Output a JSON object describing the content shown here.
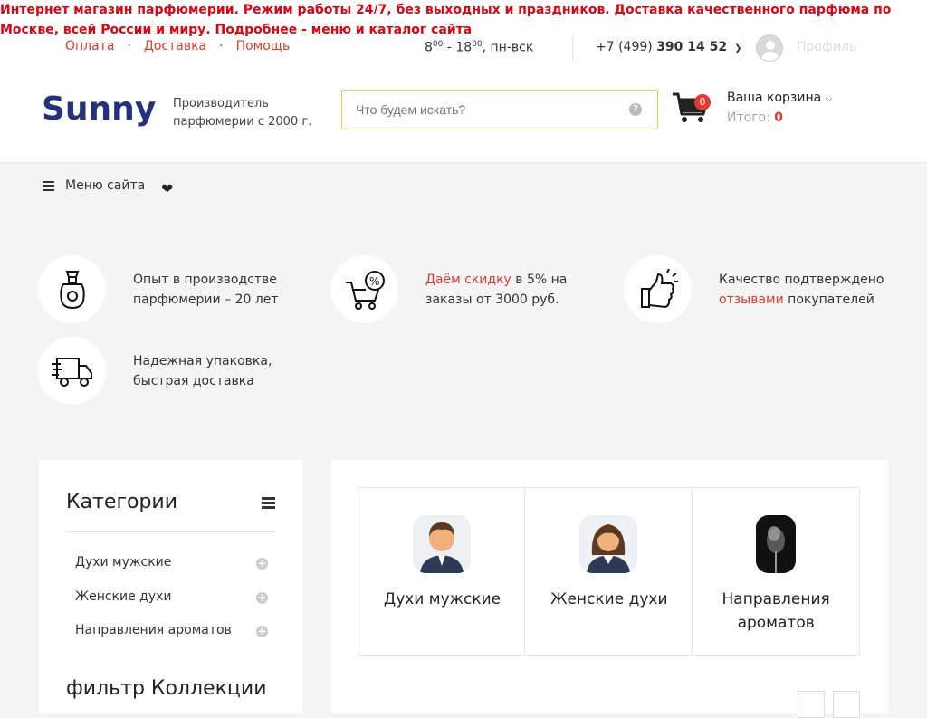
{
  "announcement": "Интернет магазин парфюмерии. Режим работы 24/7, без выходных и праздников. Доставка качественного парфюма по Москве, всей России и миру. Подробнее - меню и каталог сайта",
  "toplinks": [
    "Оплата",
    "Доставка",
    "Помощь"
  ],
  "hours": {
    "from": "8",
    "from_min": "00",
    "to": "18",
    "to_min": "00",
    "days": "пн-вск"
  },
  "phone": {
    "prefix": "+7 (499)",
    "number": "390 14 52"
  },
  "profile_label": "Профиль",
  "logo_text": "Sunny",
  "tagline": [
    "Производитель",
    "парфюмерии с 2000 г."
  ],
  "search": {
    "placeholder": "Что будем искать?"
  },
  "cart": {
    "count": "0",
    "title": "Ваша корзина",
    "total_label": "Итого:",
    "total_value": "0"
  },
  "menu_label": "Меню сайта",
  "features": [
    {
      "icon": "perfume-bottle-icon",
      "text": [
        "Опыт в производстве",
        "парфюмерии – 20 лет"
      ]
    },
    {
      "icon": "cart-discount-icon",
      "link": "Даём скидку",
      "text": [
        " в 5% на",
        "заказы от 3000 руб."
      ]
    },
    {
      "icon": "thumbs-up-icon",
      "text": [
        "Качество подтверждено"
      ],
      "link": "отзывами",
      "text_after": " покупателей"
    },
    {
      "icon": "delivery-truck-icon",
      "text": [
        "Надежная упаковка,",
        "быстрая доставка"
      ]
    }
  ],
  "sidebar": {
    "title": "Категории",
    "items": [
      "Духи мужские",
      "Женские духи",
      "Направления ароматов"
    ],
    "filter_title": "фильтр Коллекции"
  },
  "categories": [
    {
      "label": "Духи мужские",
      "icon": "man-avatar-icon"
    },
    {
      "label": "Женские духи",
      "icon": "woman-avatar-icon"
    },
    {
      "label": "Направления ароматов",
      "icon": "smoke-icon"
    }
  ],
  "colors": {
    "accent": "#e33a2b",
    "announce": "#e3000f",
    "logo": "#23327a",
    "search_border": "#f2c94c"
  }
}
